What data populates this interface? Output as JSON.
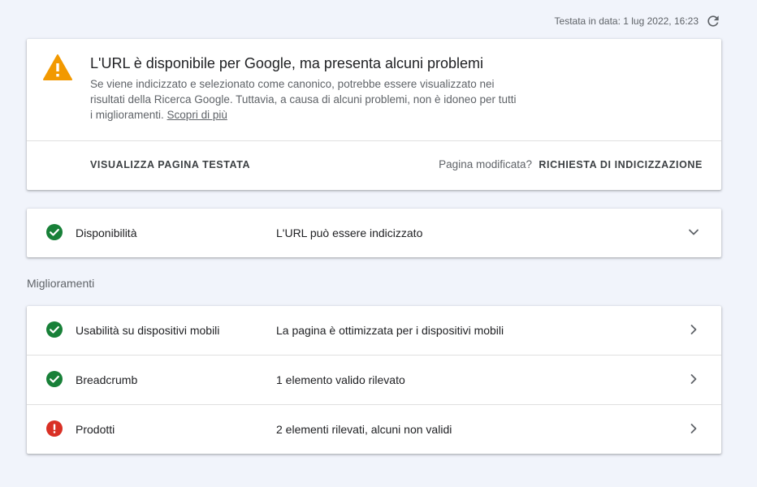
{
  "header": {
    "tested_on": "Testata in data: 1 lug 2022, 16:23",
    "refresh_icon": "refresh-icon"
  },
  "status": {
    "icon": "warning-icon",
    "icon_color": "#f29900",
    "title": "L'URL è disponibile per Google, ma presenta alcuni problemi",
    "description": "Se viene indicizzato e selezionato come canonico, potrebbe essere visualizzato nei risultati della Ricerca Google. Tuttavia, a causa di alcuni problemi, non è idoneo per tutti i miglioramenti.",
    "learn_more": "Scopri di più",
    "view_tested_page": "VISUALIZZA PAGINA TESTATA",
    "page_modified": "Pagina modificata?",
    "request_indexing": "RICHIESTA DI INDICIZZAZIONE"
  },
  "availability": {
    "label": "Disponibilità",
    "value": "L'URL può essere indicizzato",
    "status_icon": "check-circle-icon",
    "chevron_icon": "chevron-down-icon"
  },
  "enhancements": {
    "title": "Miglioramenti",
    "items": [
      {
        "label": "Usabilità su dispositivi mobili",
        "value": "La pagina è ottimizzata per i dispositivi mobili",
        "status": "valid",
        "status_icon": "check-circle-icon"
      },
      {
        "label": "Breadcrumb",
        "value": "1 elemento valido rilevato",
        "status": "valid",
        "status_icon": "check-circle-icon"
      },
      {
        "label": "Prodotti",
        "value": "2 elementi rilevati, alcuni non validi",
        "status": "error",
        "status_icon": "error-circle-icon"
      }
    ]
  },
  "colors": {
    "valid": "#188038",
    "error": "#d93025",
    "background": "#f1f4fb"
  }
}
